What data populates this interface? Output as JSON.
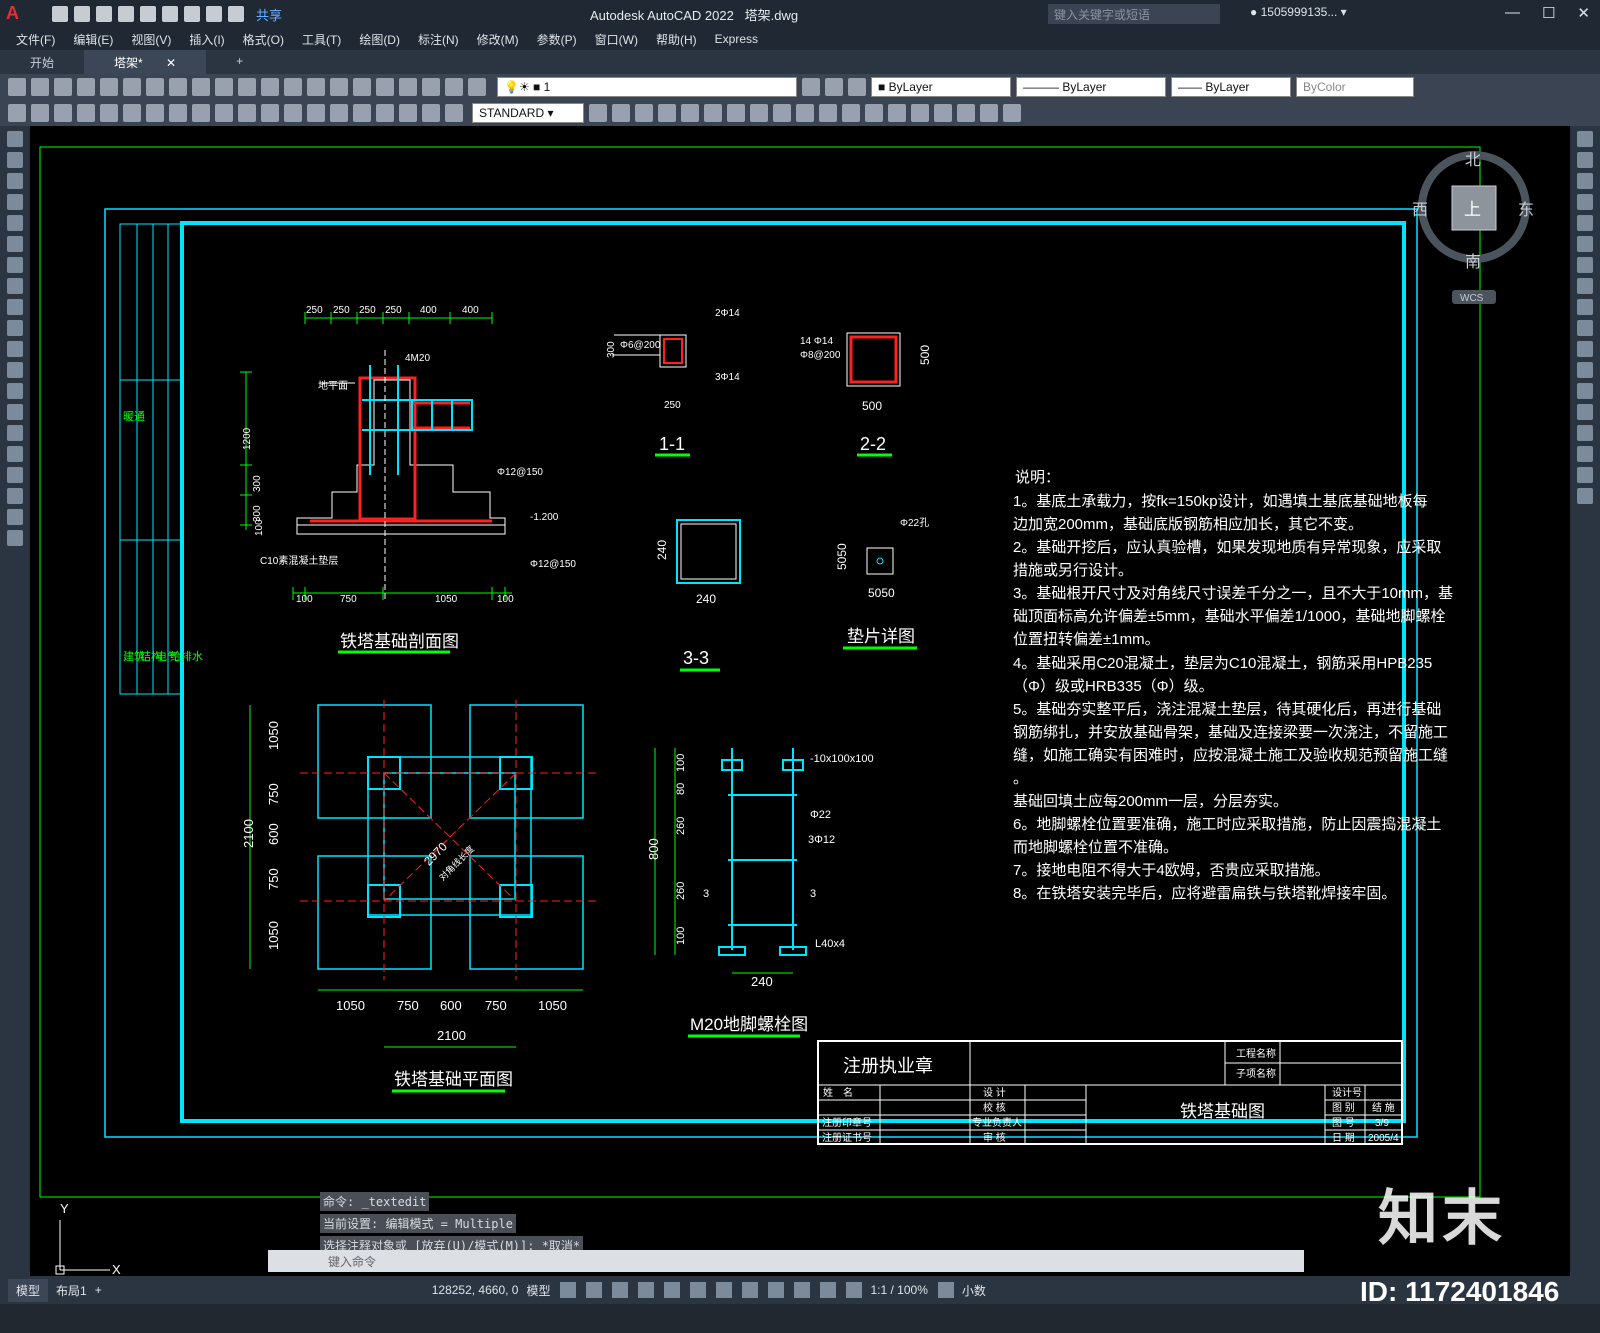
{
  "app": {
    "title": "Autodesk AutoCAD 2022",
    "file": "塔架.dwg",
    "search_placeholder": "键入关键字或短语",
    "user": "1505999135...",
    "share": "共享"
  },
  "menu": [
    "文件(F)",
    "编辑(E)",
    "视图(V)",
    "插入(I)",
    "格式(O)",
    "工具(T)",
    "绘图(D)",
    "标注(N)",
    "修改(M)",
    "参数(P)",
    "窗口(W)",
    "帮助(H)",
    "Express"
  ],
  "tabs": [
    {
      "label": "开始"
    },
    {
      "label": "塔架*"
    }
  ],
  "toolbar": {
    "layer": "1",
    "color": "ByLayer",
    "linetype": "ByLayer",
    "lineweight": "ByLayer",
    "plotstyle": "ByColor",
    "textstyle": "STANDARD"
  },
  "viewcube": {
    "north": "北",
    "south": "南",
    "east": "东",
    "west": "西",
    "top": "上",
    "wcs": "WCS"
  },
  "drawing": {
    "section_title": "铁塔基础剖面图",
    "plan_title": "铁塔基础平面图",
    "bolt_title": "M20地脚螺栓图",
    "pad_title": "垫片详图",
    "s11": "1-1",
    "s22": "2-2",
    "s33": "3-3",
    "notes_title": "说明：",
    "notes": [
      "1。基底土承载力，按fk=150kp设计，如遇填土基底基础地板每",
      "边加宽200mm，基础底版钢筋相应加长，其它不变。",
      "2。基础开挖后，应认真验槽，如果发现地质有异常现象，应采取",
      "措施或另行设计。",
      "3。基础根开尺寸及对角线尺寸误差千分之一，且不大于10mm，基",
      "础顶面标高允许偏差±5mm，基础水平偏差1/1000，基础地脚螺栓",
      "位置扭转偏差±1mm。",
      "4。基础采用C20混凝土，垫层为C10混凝土，钢筋采用HPB235",
      "（Φ）级或HRB335（Φ）级。",
      "5。基础夯实整平后，浇注混凝土垫层，待其硬化后，再进行基础",
      "钢筋绑扎，并安放基础骨架，基础及连接梁要一次浇注，不留施工",
      "缝，如施工确实有困难时，应按混凝土施工及验收规范预留施工缝",
      "。",
      "基础回填土应每200mm一层，分层夯实。",
      "6。地脚螺栓位置要准确，施工时应采取措施，防止因震捣混凝土",
      "而地脚螺栓位置不准确。",
      "7。接地电阻不得大于4欧姆，否贵应采取措施。",
      "8。在铁塔安装完毕后，应将避雷扁铁与铁塔靴焊接牢固。"
    ],
    "titleblock": {
      "stamp": "注册执业章",
      "project_name": "工程名称",
      "sub_name": "子项名称",
      "drawing_name": "铁塔基础图",
      "name_label": "姓　名",
      "seal_no": "注册印章号",
      "cert_no": "注册证书号",
      "design": "设 计",
      "check": "校 核",
      "lead": "专业负责人",
      "review": "审 核",
      "design_no": "设计号",
      "drawing_type": "图 别",
      "drawing_type_val": "结 施",
      "drawing_no": "图 号",
      "drawing_no_val": "3/9",
      "date": "日 期",
      "date_val": "2005/4"
    },
    "dims_top": [
      "250",
      "250",
      "250",
      "250",
      "400",
      "400"
    ],
    "dims_bottom": [
      "100",
      "750",
      "1050",
      "100"
    ],
    "dims_plan_h": [
      "1050",
      "750",
      "600",
      "750",
      "1050"
    ],
    "dims_plan_v": [
      "1050",
      "750",
      "600",
      "750",
      "1050"
    ],
    "plan_total": "2100",
    "section_labels": {
      "m20": "4M20",
      "ground": "地平面",
      "rebar1": "Φ12@150",
      "rebar2": "Φ12@150",
      "elev": "-1.200",
      "c10": "C10素混凝土垫层",
      "h1200": "1200",
      "h300a": "300",
      "h300b": "300",
      "h100": "100"
    },
    "s11_labels": {
      "a": "2Φ14",
      "b": "Φ6@200",
      "c": "3Φ14",
      "w": "250",
      "h": "300"
    },
    "s22_labels": {
      "a": "14 Φ14",
      "b": "Φ8@200",
      "w": "500",
      "h": "500"
    },
    "s33_labels": {
      "w": "240",
      "h": "240"
    },
    "pad_labels": {
      "hole": "Φ22孔",
      "w": "5050",
      "h": "5050"
    },
    "bolt_labels": {
      "plate": "-10x100x100",
      "d22": "Φ22",
      "d12": "3Φ12",
      "l40": "L40x4",
      "w": "240",
      "h800": "800",
      "d100a": "100",
      "d80": "80",
      "d260a": "260",
      "d260b": "260",
      "d100b": "100",
      "cut": "3"
    },
    "plan_diag": "2970",
    "plan_diag_label": "对角线长度",
    "side_labels": [
      "暖通",
      "建筑",
      "结构",
      "电气",
      "给排水"
    ]
  },
  "command": {
    "line1": "命令: _textedit",
    "line2": "当前设置: 编辑模式 = Multiple",
    "line3": "选择注释对象或 [放弃(U)/模式(M)]: *取消*",
    "placeholder": "键入命令"
  },
  "status": {
    "model_tab": "模型",
    "layout_tab": "布局1",
    "coords": "128252, 4660, 0",
    "space": "模型",
    "scale": "1:1 / 100%",
    "units": "小数"
  },
  "watermark": {
    "id": "ID: 1172401846",
    "logo": "知末"
  },
  "colors": {
    "accent": "#00e5ff",
    "red": "#ff2020",
    "green": "#00ff00",
    "canvas": "#000000"
  }
}
